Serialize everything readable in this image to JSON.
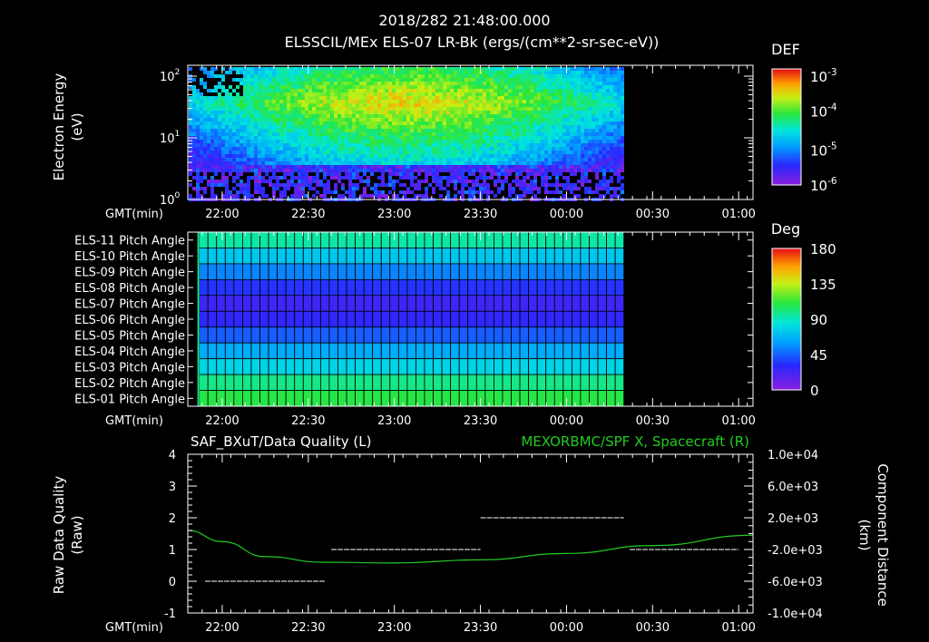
{
  "header": {
    "line1": "2018/282 21:48:00.000",
    "line2": "ELSSCIL/MEx ELS-07 LR-Bk  (ergs/(cm**2-sr-sec-eV))"
  },
  "colors": {
    "background": "#000000",
    "foreground": "#ffffff",
    "spacecraft_line": "#22cc22",
    "quality_line": "#ffffff"
  },
  "time_axis": {
    "label": "GMT(min)",
    "ticks": [
      "22:00",
      "22:30",
      "23:00",
      "23:30",
      "00:00",
      "00:30",
      "01:00"
    ]
  },
  "chart_data": [
    {
      "id": "energy_spectrogram",
      "type": "heatmap",
      "ylabel": "Electron Energy (eV)",
      "ylabel_lines": [
        "Electron Energy",
        "(eV)"
      ],
      "yscale": "log",
      "ylim": [
        1,
        150
      ],
      "yticks": [
        {
          "value": 1,
          "base": "10",
          "exp": "0"
        },
        {
          "value": 10,
          "base": "10",
          "exp": "1"
        },
        {
          "value": 100,
          "base": "10",
          "exp": "2"
        }
      ],
      "x_range": [
        "21:48",
        "01:05"
      ],
      "data_end": "00:20",
      "colorbar": {
        "title": "DEF",
        "scale": "log",
        "range": [
          1e-06,
          0.001
        ],
        "ticks": [
          {
            "base": "10",
            "exp": "-3"
          },
          {
            "base": "10",
            "exp": "-4"
          },
          {
            "base": "10",
            "exp": "-5"
          },
          {
            "base": "10",
            "exp": "-6"
          }
        ]
      }
    },
    {
      "id": "pitch_angle",
      "type": "heatmap",
      "rows": [
        "ELS-11 Pitch Angle",
        "ELS-10 Pitch Angle",
        "ELS-09 Pitch Angle",
        "ELS-08 Pitch Angle",
        "ELS-07 Pitch Angle",
        "ELS-06 Pitch Angle",
        "ELS-05 Pitch Angle",
        "ELS-04 Pitch Angle",
        "ELS-03 Pitch Angle",
        "ELS-02 Pitch Angle",
        "ELS-01 Pitch Angle"
      ],
      "row_values_deg": [
        95,
        75,
        55,
        35,
        25,
        30,
        45,
        65,
        80,
        100,
        110
      ],
      "x_range": [
        "21:48",
        "01:05"
      ],
      "data_start": "21:52",
      "data_end": "00:20",
      "colorbar": {
        "title": "Deg",
        "range": [
          0,
          180
        ],
        "ticks": [
          "180",
          "135",
          "90",
          "45",
          "0"
        ]
      }
    },
    {
      "id": "quality_and_distance",
      "type": "line",
      "title_left": "SAF_BXuT/Data Quality (L)",
      "title_right": "MEXORBMC/SPF X, Spacecraft (R)",
      "ylabel_left_lines": [
        "Raw Data Quality",
        "(Raw)"
      ],
      "ylabel_right_lines": [
        "Component Distance",
        "(km)"
      ],
      "ylim_left": [
        -1,
        4
      ],
      "yticks_left": [
        "4",
        "3",
        "2",
        "1",
        "0",
        "-1"
      ],
      "ylim_right": [
        -10000,
        10000
      ],
      "yticks_right": [
        "1.0e+04",
        "6.0e+03",
        "2.0e+03",
        "-2.0e+03",
        "-6.0e+03",
        "-1.0e+04"
      ],
      "series": [
        {
          "name": "SAF_BXuT/Data Quality",
          "axis": "left",
          "segments": [
            {
              "from": "21:54",
              "to": "22:36",
              "value": 0
            },
            {
              "from": "22:38",
              "to": "23:30",
              "value": 1
            },
            {
              "from": "23:30",
              "to": "00:20",
              "value": 2
            },
            {
              "from": "00:22",
              "to": "01:00",
              "value": 1
            }
          ]
        },
        {
          "name": "MEXORBMC/SPF X, Spacecraft",
          "axis": "right",
          "points": [
            {
              "t": "21:48",
              "v": 400
            },
            {
              "t": "22:00",
              "v": -1000
            },
            {
              "t": "22:15",
              "v": -2900
            },
            {
              "t": "22:35",
              "v": -3600
            },
            {
              "t": "23:00",
              "v": -3700
            },
            {
              "t": "23:30",
              "v": -3300
            },
            {
              "t": "00:00",
              "v": -2500
            },
            {
              "t": "00:30",
              "v": -1500
            },
            {
              "t": "01:05",
              "v": -200
            }
          ]
        }
      ]
    }
  ]
}
